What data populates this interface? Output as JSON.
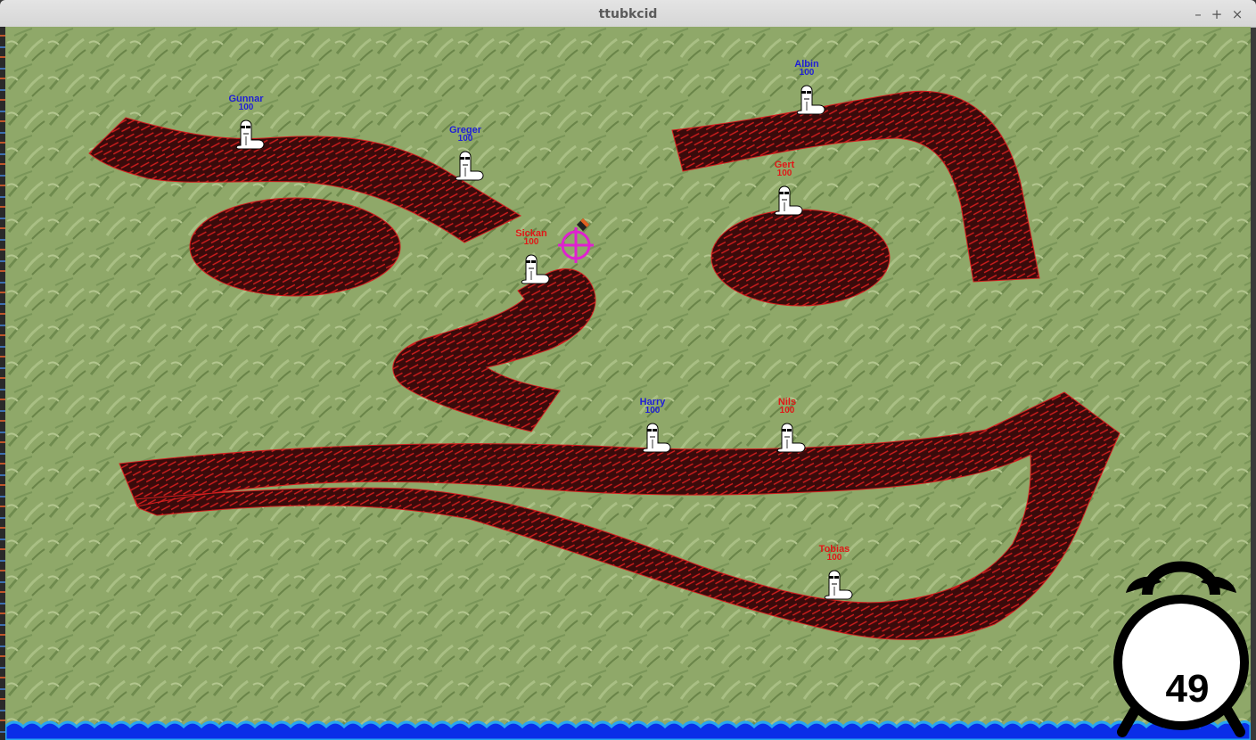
{
  "window": {
    "title": "ttubkcid",
    "minimize_glyph": "–",
    "maximize_glyph": "+",
    "close_glyph": "×"
  },
  "worms": [
    {
      "name": "Gunnar",
      "hp": "100",
      "team": "blue"
    },
    {
      "name": "Greger",
      "hp": "100",
      "team": "blue"
    },
    {
      "name": "Albin",
      "hp": "100",
      "team": "blue"
    },
    {
      "name": "Harry",
      "hp": "100",
      "team": "blue"
    },
    {
      "name": "Gert",
      "hp": "100",
      "team": "red"
    },
    {
      "name": "Sickan",
      "hp": "100",
      "team": "red"
    },
    {
      "name": "Nils",
      "hp": "100",
      "team": "red"
    },
    {
      "name": "Tobias",
      "hp": "100",
      "team": "red"
    }
  ],
  "team_colors": {
    "blue": "#1f1fd6",
    "red": "#e01818"
  },
  "active_worm": "Sickan",
  "turn_timer": "49",
  "colors": {
    "grass": "#8fa869",
    "terrain": "#3a0b0b",
    "terrain_hatch": "#d41e1e",
    "water": "#0a2ee8",
    "water_crest": "#27a6f0",
    "crosshair": "#e020d0"
  }
}
